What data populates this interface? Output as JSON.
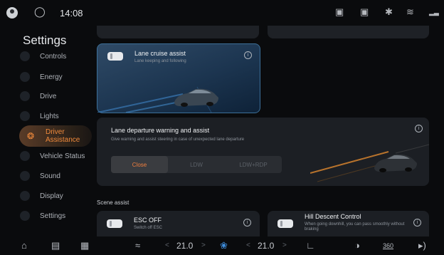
{
  "status_bar": {
    "time": "14:08",
    "message_icon": "chat-bubble-icon",
    "icons": [
      "screen-off-icon",
      "screen-icon",
      "bluetooth-icon",
      "wifi-icon",
      "signal-icon"
    ]
  },
  "sidebar": {
    "title": "Settings",
    "items": [
      {
        "label": "Controls",
        "icon": "controls-icon"
      },
      {
        "label": "Energy",
        "icon": "energy-icon"
      },
      {
        "label": "Drive",
        "icon": "drive-icon"
      },
      {
        "label": "Lights",
        "icon": "lights-icon"
      },
      {
        "label": "Driver Assistance",
        "label_line1": "Driver",
        "label_line2": "Assistance",
        "icon": "steering-wheel-icon",
        "active": true
      },
      {
        "label": "Vehicle Status",
        "icon": "vehicle-status-icon"
      },
      {
        "label": "Sound",
        "icon": "sound-icon"
      },
      {
        "label": "Display",
        "icon": "display-icon"
      },
      {
        "label": "Settings",
        "icon": "settings-icon"
      }
    ]
  },
  "lane_cruise": {
    "title": "Lane cruise assist",
    "subtitle": "Lane keeping and following",
    "enabled": false
  },
  "lane_departure": {
    "title": "Lane departure warning and assist",
    "subtitle": "Give warning and assist steering in case of unexpected lane departure",
    "options": [
      "Close",
      "LDW",
      "LDW+RDP"
    ],
    "selected": "Close"
  },
  "scene_assist": {
    "label": "Scene assist",
    "esc": {
      "title": "ESC OFF",
      "subtitle": "Switch off ESC"
    },
    "hdc": {
      "title": "Hill Descent Control",
      "subtitle": "When going downhill, you can pass smoothly without braking"
    }
  },
  "bottom_bar": {
    "left_temp": "21.0",
    "right_temp": "21.0",
    "temp_unit_glyph": "°",
    "view_360": "360",
    "icons": [
      "home-icon",
      "car-icon",
      "apps-grid-icon",
      "seat-heat-icon",
      "fan-icon",
      "seat-icon",
      "car-side-icon",
      "camera-360-icon",
      "volume-icon"
    ]
  },
  "colors": {
    "accent": "#f08a3c",
    "card_bg": "#1c1f24",
    "lane_card_border": "#3c6f98"
  }
}
